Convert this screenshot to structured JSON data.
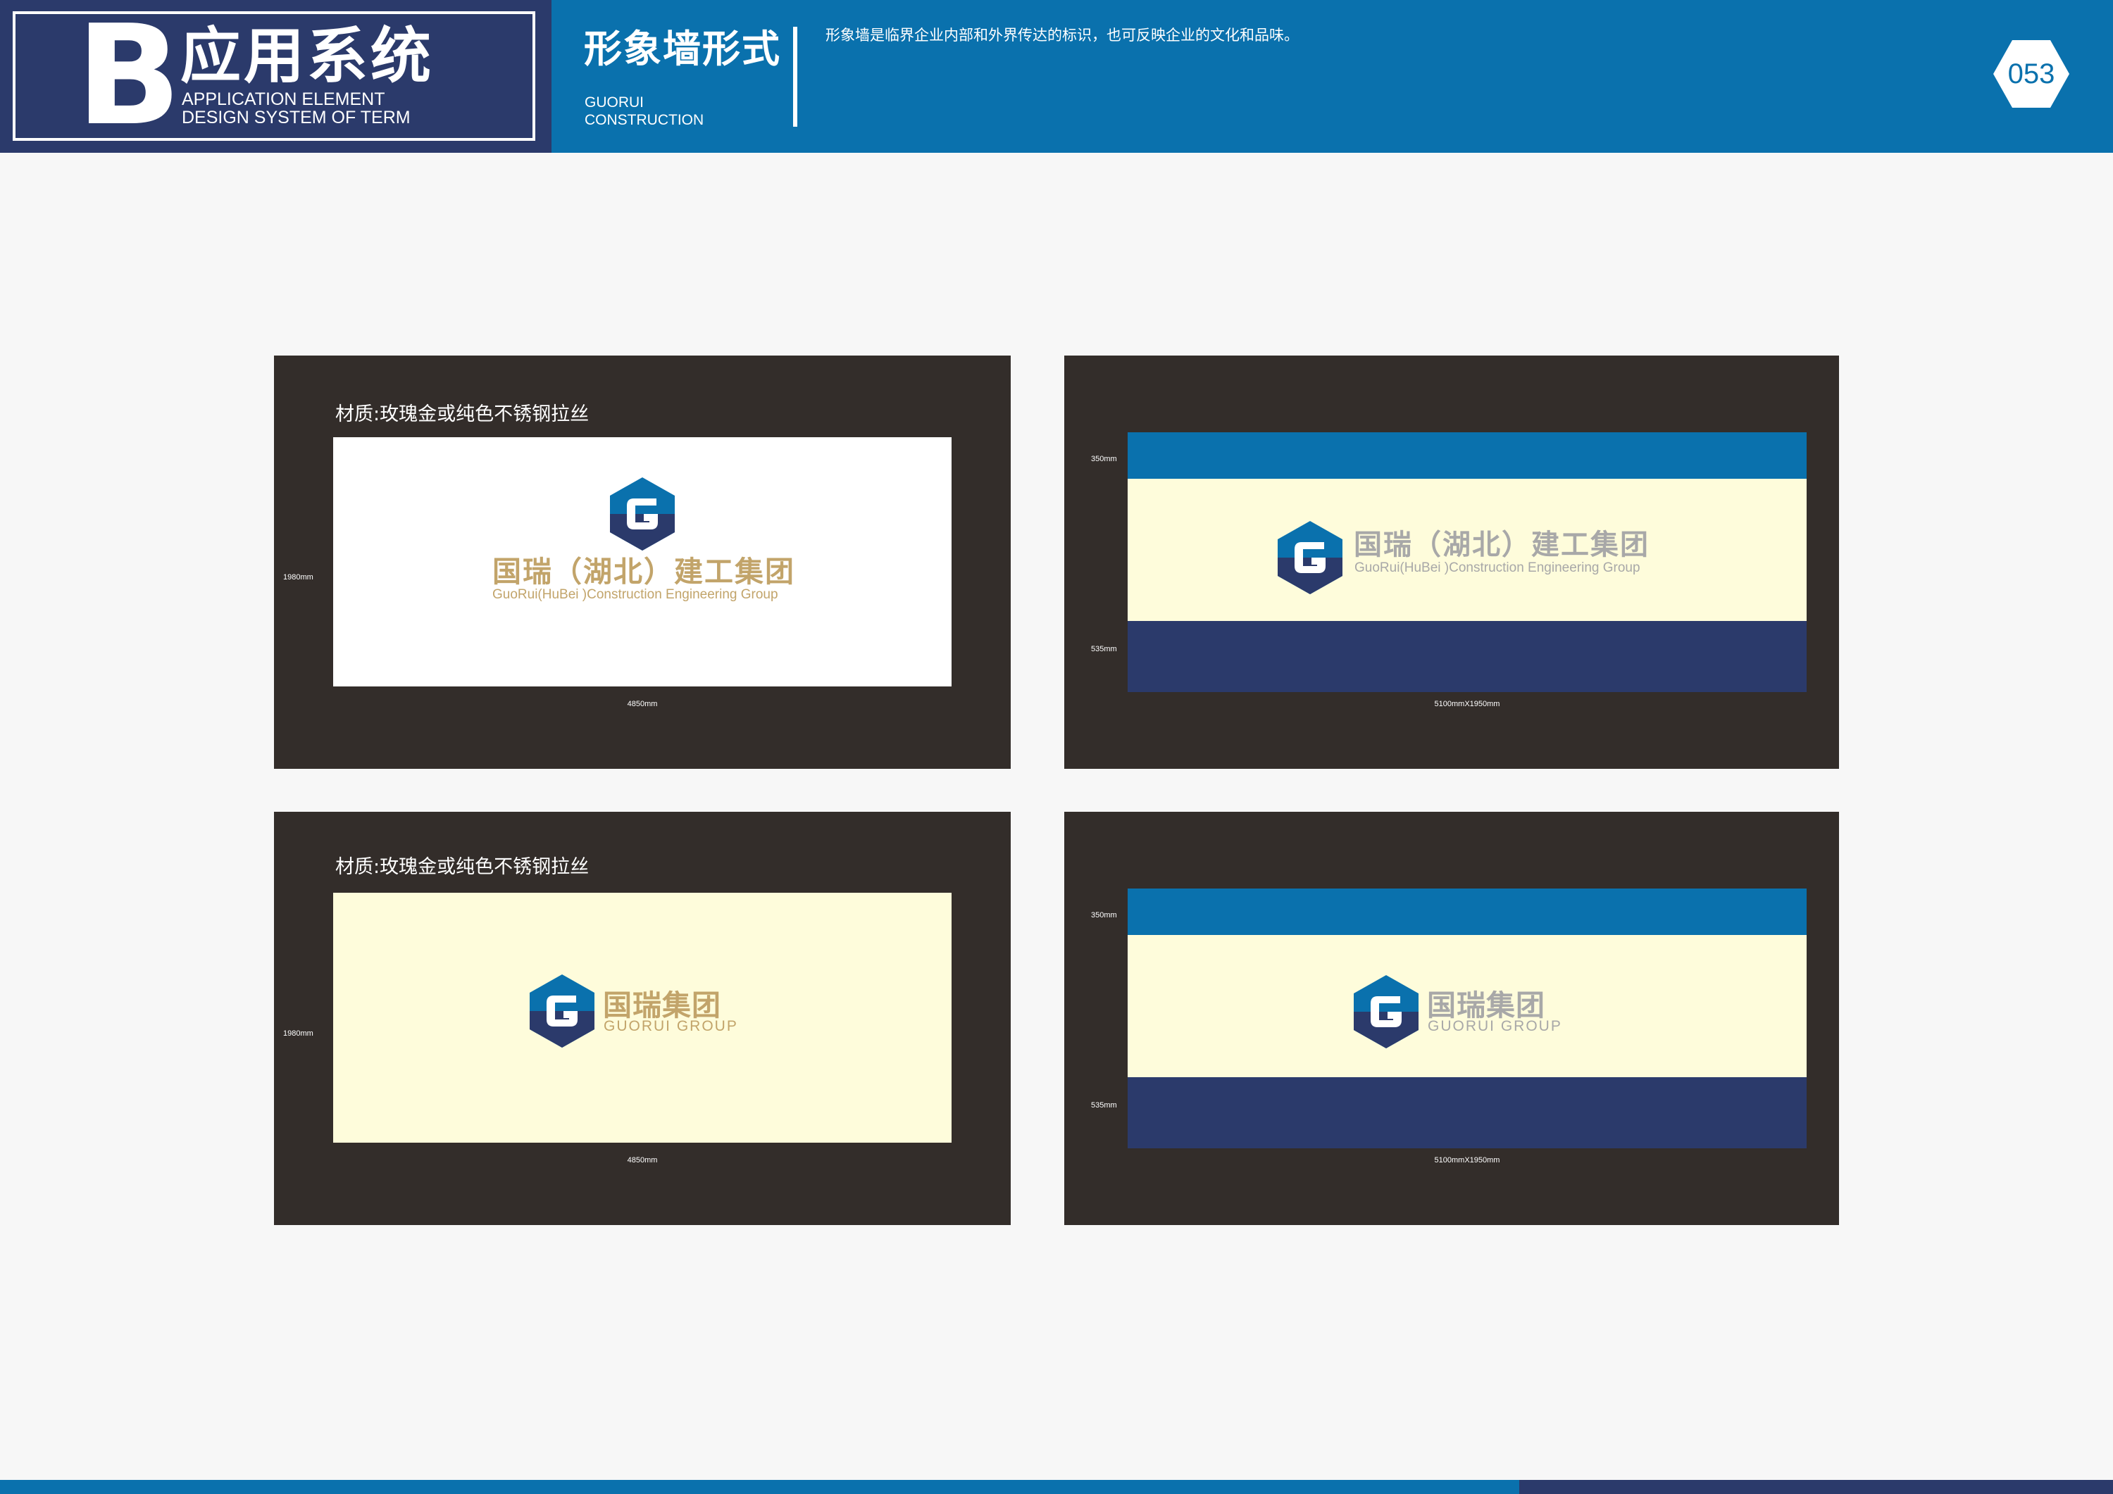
{
  "header": {
    "section_letter": "B",
    "section_title_cn": "应用系统",
    "section_title_en": [
      "APPLICATION ELEMENT",
      "DESIGN SYSTEM OF TERM"
    ],
    "sub_title_cn": "形象墙形式",
    "sub_title_en": [
      "GUORUI",
      "CONSTRUCTION"
    ],
    "description": "形象墙是临界企业内部和外界传达的标识，也可反映企业的文化和品味。",
    "page_number": "053"
  },
  "panels": {
    "top_left": {
      "label": "材质:玫瑰金或纯色不锈钢拉丝",
      "height_dim": "1980mm",
      "width_dim": "4850mm",
      "logo_cn": "国瑞（湖北）建工集团",
      "logo_en": "GuoRui(HuBei )Construction Engineering Group"
    },
    "top_right": {
      "top_band_dim": "350mm",
      "bottom_band_dim": "535mm",
      "size_dim": "5100mmX1950mm",
      "logo_cn": "国瑞（湖北）建工集团",
      "logo_en": "GuoRui(HuBei )Construction Engineering Group"
    },
    "bottom_left": {
      "label": "材质:玫瑰金或纯色不锈钢拉丝",
      "height_dim": "1980mm",
      "width_dim": "4850mm",
      "logo_cn": "国瑞集团",
      "logo_en": "GUORUI GROUP"
    },
    "bottom_right": {
      "top_band_dim": "350mm",
      "bottom_band_dim": "535mm",
      "size_dim": "5100mmX1950mm",
      "logo_cn": "国瑞集团",
      "logo_en": "GUORUI GROUP"
    }
  },
  "colors": {
    "brand_blue": "#0a71ad",
    "brand_navy": "#2b3a6b",
    "panel_dark": "#332d2a",
    "wall_cream": "#fefcdb",
    "logo_gold": "#c2a46a",
    "logo_silver": "#a8a8a8"
  }
}
